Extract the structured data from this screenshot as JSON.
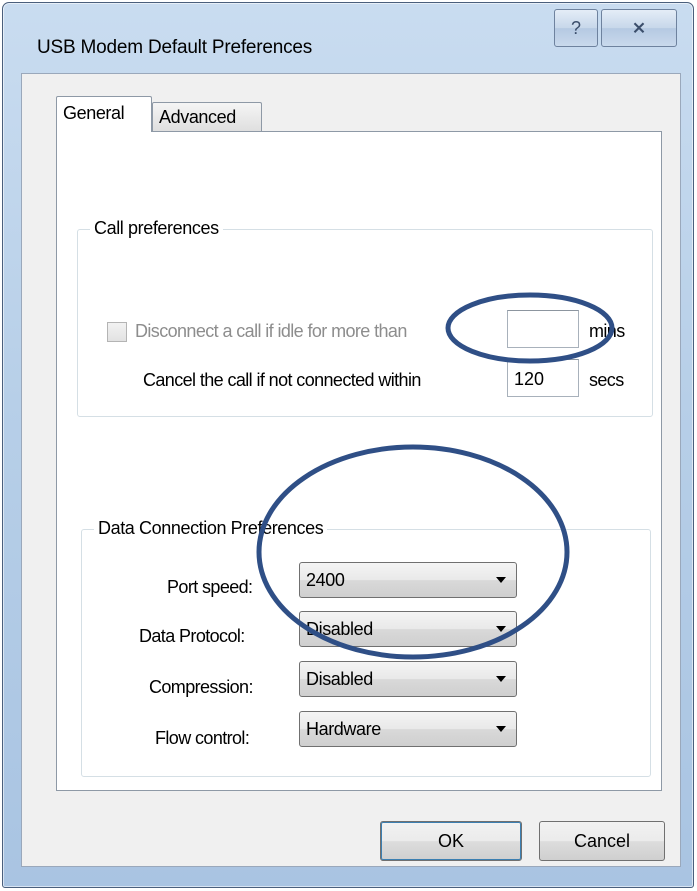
{
  "window": {
    "title": "USB Modem Default Preferences",
    "help_glyph": "?",
    "close_glyph": "⨯"
  },
  "tabs": [
    {
      "label": "General",
      "active": true
    },
    {
      "label": "Advanced",
      "active": false
    }
  ],
  "call_preferences": {
    "legend": "Call preferences",
    "idle": {
      "label": "Disconnect a call if idle for more than",
      "checked": false,
      "enabled": false,
      "value": "",
      "unit": "mins"
    },
    "cancel": {
      "label": "Cancel the call if not connected within",
      "value": "120",
      "unit": "secs"
    }
  },
  "data_connection": {
    "legend": "Data Connection Preferences",
    "fields": [
      {
        "label": "Port speed:",
        "value": "2400"
      },
      {
        "label": "Data Protocol:",
        "value": "Disabled"
      },
      {
        "label": "Compression:",
        "value": "Disabled"
      },
      {
        "label": "Flow control:",
        "value": "Hardware"
      }
    ]
  },
  "buttons": {
    "ok": "OK",
    "cancel": "Cancel"
  },
  "annotation_color": "#2f4f86"
}
